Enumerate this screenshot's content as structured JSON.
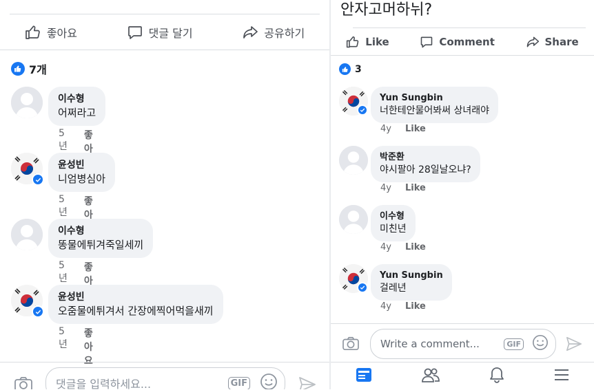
{
  "left": {
    "truncated_text": "· · · · · · · · · · · · · · · · · ·",
    "actions": {
      "like": "좋아요",
      "comment": "댓글 달기",
      "share": "공유하기"
    },
    "reaction_count": "7개",
    "comments": [
      {
        "name": "이수형",
        "text": "어쩌라고",
        "time": "5년",
        "like": "좋아요"
      },
      {
        "name": "윤성빈",
        "text": "니엄병심아",
        "time": "5년",
        "like": "좋아요"
      },
      {
        "name": "이수형",
        "text": "똥물에튀겨죽일세끼",
        "time": "5년",
        "like": "좋아요"
      },
      {
        "name": "윤성빈",
        "text": "오줌물에튀겨서 간장에찍어먹을새끼",
        "time": "5년",
        "like": "좋아요"
      }
    ],
    "composer": {
      "placeholder": "댓글을 입력하세요...",
      "gif": "GIF"
    }
  },
  "right": {
    "post_text": "안자고머하뉘?",
    "actions": {
      "like": "Like",
      "comment": "Comment",
      "share": "Share"
    },
    "reaction_count": "3",
    "comments": [
      {
        "name": "Yun Sungbin",
        "text": "너한테안물어봐써 상녀래야",
        "time": "4y",
        "like": "Like"
      },
      {
        "name": "박준환",
        "text": "야시팔아 28일날오냐?",
        "time": "4y",
        "like": "Like"
      },
      {
        "name": "이수형",
        "text": "미친년",
        "time": "4y",
        "like": "Like"
      },
      {
        "name": "Yun Sungbin",
        "text": "걸레년",
        "time": "4y",
        "like": "Like"
      }
    ],
    "composer": {
      "placeholder": "Write a comment...",
      "gif": "GIF"
    }
  },
  "colors": {
    "accent": "#1877f2",
    "bubble": "#f0f2f5",
    "muted": "#65676b"
  }
}
